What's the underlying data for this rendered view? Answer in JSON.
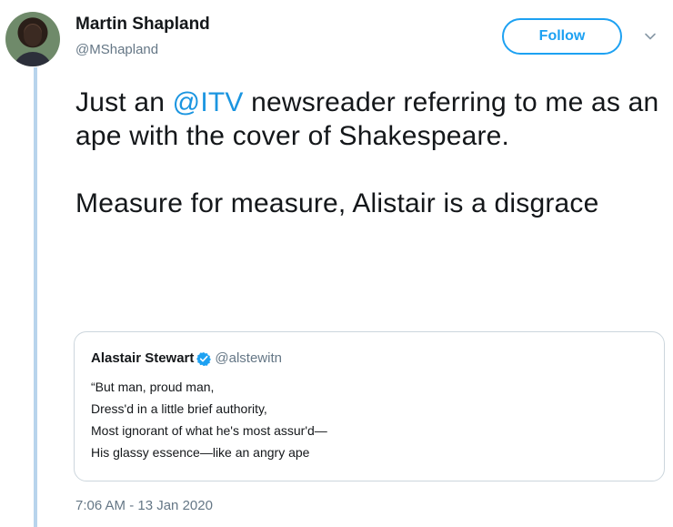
{
  "tweet": {
    "author_name": "Martin Shapland",
    "author_handle": "@MShapland",
    "follow_label": "Follow",
    "text_part1": "Just an ",
    "mention": "@ITV",
    "text_part2": " newsreader referring to me as an ape with the cover of Shakespeare.",
    "text_paragraph2": "Measure for measure, Alistair is a disgrace",
    "timestamp": "7:06 AM - 13 Jan 2020"
  },
  "quoted_tweet": {
    "author_name": "Alastair Stewart",
    "author_handle": "@alstewitn",
    "lines": [
      "“But man, proud man,",
      "Dress'd in a little brief authority,",
      "Most ignorant of what he's most assur'd—",
      "His glassy essence—like an angry ape"
    ]
  },
  "colors": {
    "link": "#1b95e0",
    "follow_accent": "#1da1f2",
    "secondary_text": "#657786",
    "thread_line": "#b8d4ec",
    "verified": "#1da1f2"
  },
  "icons": {
    "menu": "chevron-down-icon",
    "verified": "verified-badge-icon"
  }
}
